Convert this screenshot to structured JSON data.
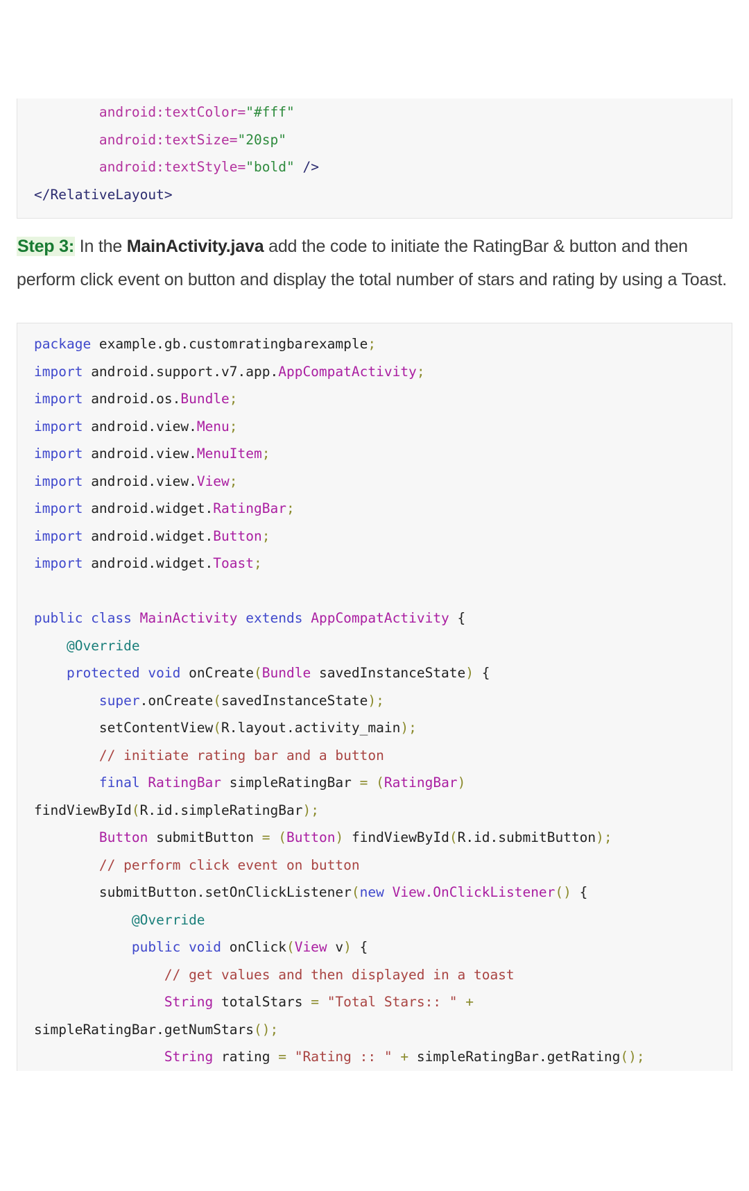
{
  "page": {
    "background": "#ffffff",
    "accent_step_color": "#187a32",
    "accent_step_bg": "#e8f5e0"
  },
  "xml_block": {
    "name": "activity-main-xml-tail",
    "lines": [
      [
        {
          "t": "        ",
          "c": "pl"
        },
        {
          "t": "android:textColor=",
          "c": "xa"
        },
        {
          "t": "\"#fff\"",
          "c": "xv"
        }
      ],
      [
        {
          "t": "        ",
          "c": "pl"
        },
        {
          "t": "android:textSize=",
          "c": "xa"
        },
        {
          "t": "\"20sp\"",
          "c": "xv"
        }
      ],
      [
        {
          "t": "        ",
          "c": "pl"
        },
        {
          "t": "android:textStyle=",
          "c": "xa"
        },
        {
          "t": "\"bold\"",
          "c": "xv"
        },
        {
          "t": " ",
          "c": "pl"
        },
        {
          "t": "/>",
          "c": "xt"
        }
      ],
      [
        {
          "t": "</RelativeLayout>",
          "c": "xt"
        }
      ]
    ]
  },
  "step3": {
    "label": "Step 3:",
    "text_before_bold": " In the ",
    "bold_term": "MainActivity.java",
    "text_after_bold": " add the code to initiate the RatingBar & button and then perform click event on button and display the total number of stars and rating by using a Toast."
  },
  "java_block": {
    "name": "main-activity-java",
    "lines": [
      [
        {
          "t": "package",
          "c": "k"
        },
        {
          "t": " example.gb.customratingbarexample",
          "c": "pl"
        },
        {
          "t": ";",
          "c": "op"
        }
      ],
      [
        {
          "t": "import",
          "c": "k"
        },
        {
          "t": " android.support.v7.app.",
          "c": "pl"
        },
        {
          "t": "AppCompatActivity",
          "c": "ty"
        },
        {
          "t": ";",
          "c": "op"
        }
      ],
      [
        {
          "t": "import",
          "c": "k"
        },
        {
          "t": " android.os.",
          "c": "pl"
        },
        {
          "t": "Bundle",
          "c": "ty"
        },
        {
          "t": ";",
          "c": "op"
        }
      ],
      [
        {
          "t": "import",
          "c": "k"
        },
        {
          "t": " android.view.",
          "c": "pl"
        },
        {
          "t": "Menu",
          "c": "ty"
        },
        {
          "t": ";",
          "c": "op"
        }
      ],
      [
        {
          "t": "import",
          "c": "k"
        },
        {
          "t": " android.view.",
          "c": "pl"
        },
        {
          "t": "MenuItem",
          "c": "ty"
        },
        {
          "t": ";",
          "c": "op"
        }
      ],
      [
        {
          "t": "import",
          "c": "k"
        },
        {
          "t": " android.view.",
          "c": "pl"
        },
        {
          "t": "View",
          "c": "ty"
        },
        {
          "t": ";",
          "c": "op"
        }
      ],
      [
        {
          "t": "import",
          "c": "k"
        },
        {
          "t": " android.widget.",
          "c": "pl"
        },
        {
          "t": "RatingBar",
          "c": "ty"
        },
        {
          "t": ";",
          "c": "op"
        }
      ],
      [
        {
          "t": "import",
          "c": "k"
        },
        {
          "t": " android.widget.",
          "c": "pl"
        },
        {
          "t": "Button",
          "c": "ty"
        },
        {
          "t": ";",
          "c": "op"
        }
      ],
      [
        {
          "t": "import",
          "c": "k"
        },
        {
          "t": " android.widget.",
          "c": "pl"
        },
        {
          "t": "Toast",
          "c": "ty"
        },
        {
          "t": ";",
          "c": "op"
        }
      ],
      [
        {
          "t": "",
          "c": "pl"
        }
      ],
      [
        {
          "t": "public class",
          "c": "k"
        },
        {
          "t": " ",
          "c": "pl"
        },
        {
          "t": "MainActivity",
          "c": "ty"
        },
        {
          "t": " ",
          "c": "pl"
        },
        {
          "t": "extends",
          "c": "k"
        },
        {
          "t": " ",
          "c": "pl"
        },
        {
          "t": "AppCompatActivity",
          "c": "ty"
        },
        {
          "t": " {",
          "c": "pl"
        }
      ],
      [
        {
          "t": "    ",
          "c": "pl"
        },
        {
          "t": "@Override",
          "c": "ann"
        }
      ],
      [
        {
          "t": "    ",
          "c": "pl"
        },
        {
          "t": "protected void",
          "c": "k"
        },
        {
          "t": " onCreate",
          "c": "pl"
        },
        {
          "t": "(",
          "c": "op"
        },
        {
          "t": "Bundle",
          "c": "ty"
        },
        {
          "t": " savedInstanceState",
          "c": "pl"
        },
        {
          "t": ")",
          "c": "op"
        },
        {
          "t": " {",
          "c": "pl"
        }
      ],
      [
        {
          "t": "        ",
          "c": "pl"
        },
        {
          "t": "super",
          "c": "k"
        },
        {
          "t": ".onCreate",
          "c": "pl"
        },
        {
          "t": "(",
          "c": "op"
        },
        {
          "t": "savedInstanceState",
          "c": "pl"
        },
        {
          "t": ");",
          "c": "op"
        }
      ],
      [
        {
          "t": "        ",
          "c": "pl"
        },
        {
          "t": "setContentView",
          "c": "pl"
        },
        {
          "t": "(",
          "c": "op"
        },
        {
          "t": "R.layout.activity_main",
          "c": "pl"
        },
        {
          "t": ");",
          "c": "op"
        }
      ],
      [
        {
          "t": "        ",
          "c": "pl"
        },
        {
          "t": "// initiate rating bar and a button",
          "c": "cmt"
        }
      ],
      [
        {
          "t": "        ",
          "c": "pl"
        },
        {
          "t": "final",
          "c": "k"
        },
        {
          "t": " ",
          "c": "pl"
        },
        {
          "t": "RatingBar",
          "c": "ty"
        },
        {
          "t": " simpleRatingBar ",
          "c": "pl"
        },
        {
          "t": "=",
          "c": "op"
        },
        {
          "t": " ",
          "c": "pl"
        },
        {
          "t": "(",
          "c": "op"
        },
        {
          "t": "RatingBar",
          "c": "ty"
        },
        {
          "t": ")",
          "c": "op"
        },
        {
          "t": " findViewById",
          "c": "pl"
        },
        {
          "t": "(",
          "c": "op"
        },
        {
          "t": "R.id.simpleRatingBar",
          "c": "pl"
        },
        {
          "t": ");",
          "c": "op"
        }
      ],
      [
        {
          "t": "        ",
          "c": "pl"
        },
        {
          "t": "Button",
          "c": "ty"
        },
        {
          "t": " submitButton ",
          "c": "pl"
        },
        {
          "t": "=",
          "c": "op"
        },
        {
          "t": " ",
          "c": "pl"
        },
        {
          "t": "(",
          "c": "op"
        },
        {
          "t": "Button",
          "c": "ty"
        },
        {
          "t": ")",
          "c": "op"
        },
        {
          "t": " findViewById",
          "c": "pl"
        },
        {
          "t": "(",
          "c": "op"
        },
        {
          "t": "R.id.submitButton",
          "c": "pl"
        },
        {
          "t": ");",
          "c": "op"
        }
      ],
      [
        {
          "t": "        ",
          "c": "pl"
        },
        {
          "t": "// perform click event on button",
          "c": "cmt"
        }
      ],
      [
        {
          "t": "        ",
          "c": "pl"
        },
        {
          "t": "submitButton.setOnClickListener",
          "c": "pl"
        },
        {
          "t": "(",
          "c": "op"
        },
        {
          "t": "new",
          "c": "k"
        },
        {
          "t": " ",
          "c": "pl"
        },
        {
          "t": "View.OnClickListener",
          "c": "ty"
        },
        {
          "t": "()",
          "c": "op"
        },
        {
          "t": " {",
          "c": "pl"
        }
      ],
      [
        {
          "t": "            ",
          "c": "pl"
        },
        {
          "t": "@Override",
          "c": "ann"
        }
      ],
      [
        {
          "t": "            ",
          "c": "pl"
        },
        {
          "t": "public void",
          "c": "k"
        },
        {
          "t": " onClick",
          "c": "pl"
        },
        {
          "t": "(",
          "c": "op"
        },
        {
          "t": "View",
          "c": "ty"
        },
        {
          "t": " v",
          "c": "pl"
        },
        {
          "t": ")",
          "c": "op"
        },
        {
          "t": " {",
          "c": "pl"
        }
      ],
      [
        {
          "t": "                ",
          "c": "pl"
        },
        {
          "t": "// get values and then displayed in a toast",
          "c": "cmt"
        }
      ],
      [
        {
          "t": "                ",
          "c": "pl"
        },
        {
          "t": "String",
          "c": "ty"
        },
        {
          "t": " totalStars ",
          "c": "pl"
        },
        {
          "t": "=",
          "c": "op"
        },
        {
          "t": " ",
          "c": "pl"
        },
        {
          "t": "\"Total Stars:: \"",
          "c": "str"
        },
        {
          "t": " ",
          "c": "pl"
        },
        {
          "t": "+",
          "c": "op"
        },
        {
          "t": " simpleRatingBar.getNumStars",
          "c": "pl"
        },
        {
          "t": "();",
          "c": "op"
        }
      ],
      [
        {
          "t": "                ",
          "c": "pl"
        },
        {
          "t": "String",
          "c": "ty"
        },
        {
          "t": " rating ",
          "c": "pl"
        },
        {
          "t": "=",
          "c": "op"
        },
        {
          "t": " ",
          "c": "pl"
        },
        {
          "t": "\"Rating :: \"",
          "c": "str"
        },
        {
          "t": " ",
          "c": "pl"
        },
        {
          "t": "+",
          "c": "op"
        },
        {
          "t": " simpleRatingBar.getRating",
          "c": "pl"
        },
        {
          "t": "();",
          "c": "op"
        }
      ]
    ]
  }
}
